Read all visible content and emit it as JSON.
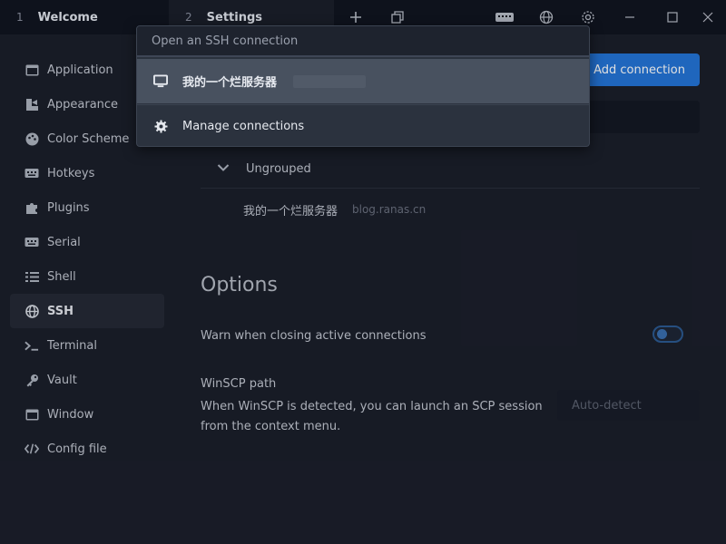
{
  "tabs": [
    {
      "num": "1",
      "title": "Welcome"
    },
    {
      "num": "2",
      "title": "Settings"
    }
  ],
  "titlebar": {
    "new_tab_icon": "plus-icon",
    "tabs_icon": "tab-stack-icon",
    "keyboard_icon": "keyboard-icon",
    "globe_icon": "globe-icon",
    "settings_icon": "gear-icon",
    "minimize_icon": "minimize-icon",
    "maximize_icon": "maximize-icon",
    "close_icon": "close-icon"
  },
  "sidebar": {
    "items": [
      {
        "label": "Application",
        "icon": "window-icon"
      },
      {
        "label": "Appearance",
        "icon": "paint-icon"
      },
      {
        "label": "Color Scheme",
        "icon": "palette-icon"
      },
      {
        "label": "Hotkeys",
        "icon": "keyboard-icon"
      },
      {
        "label": "Plugins",
        "icon": "puzzle-icon"
      },
      {
        "label": "Serial",
        "icon": "keyboard-icon"
      },
      {
        "label": "Shell",
        "icon": "list-icon"
      },
      {
        "label": "SSH",
        "icon": "globe-icon"
      },
      {
        "label": "Terminal",
        "icon": "terminal-icon"
      },
      {
        "label": "Vault",
        "icon": "key-icon"
      },
      {
        "label": "Window",
        "icon": "window-icon"
      },
      {
        "label": "Config file",
        "icon": "code-icon"
      }
    ],
    "active": "SSH"
  },
  "main": {
    "add_connection_label": "Add connection",
    "group_label": "Ungrouped",
    "connection": {
      "name": "我的一个烂服务器",
      "host": "blog.ranas.cn"
    },
    "options_title": "Options",
    "warn_label": "Warn when closing active connections",
    "warn_enabled": false,
    "winscp_title": "WinSCP path",
    "winscp_desc": "When WinSCP is detected, you can launch an SCP session from the context menu.",
    "winscp_placeholder": "Auto-detect"
  },
  "popup": {
    "placeholder": "Open an SSH connection",
    "selected_item": "我的一个烂服务器",
    "manage_label": "Manage connections"
  },
  "colors": {
    "accent": "#2475d8",
    "background": "#1b1f2b",
    "popup": "#2b323e"
  }
}
